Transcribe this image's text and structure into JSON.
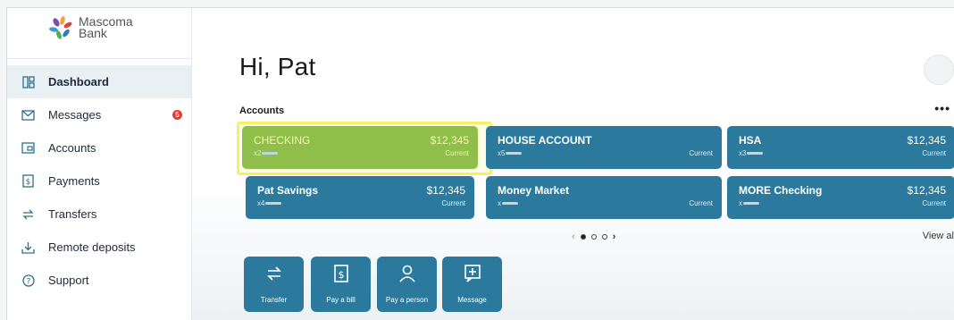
{
  "brand": {
    "name_line1": "Mascoma",
    "name_line2": "Bank"
  },
  "sidebar": {
    "items": [
      {
        "label": "Dashboard",
        "icon": "dashboard-icon",
        "active": true
      },
      {
        "label": "Messages",
        "icon": "envelope-icon",
        "badge": "5"
      },
      {
        "label": "Accounts",
        "icon": "accounts-icon"
      },
      {
        "label": "Payments",
        "icon": "dollar-doc-icon"
      },
      {
        "label": "Transfers",
        "icon": "transfer-arrows-icon"
      },
      {
        "label": "Remote deposits",
        "icon": "deposit-icon"
      },
      {
        "label": "Support",
        "icon": "help-circle-icon"
      }
    ]
  },
  "main": {
    "greeting": "Hi, Pat",
    "accounts_label": "Accounts",
    "more": "•••",
    "cards": [
      {
        "name": "CHECKING",
        "acct": "x2",
        "balance": "$12,345",
        "status": "Current"
      },
      {
        "name": "HOUSE ACCOUNT",
        "acct": "x5",
        "balance": "",
        "status": "Current"
      },
      {
        "name": "HSA",
        "acct": "x3",
        "balance": "$12,345",
        "status": "Current"
      },
      {
        "name": "Pat Savings",
        "acct": "x4",
        "balance": "$12,345",
        "status": "Current"
      },
      {
        "name": "Money Market",
        "acct": "x",
        "balance": "",
        "status": "Current"
      },
      {
        "name": "MORE Checking",
        "acct": "x",
        "balance": "$12,345",
        "status": "Current"
      }
    ],
    "pager": {
      "prev": "‹",
      "next": "›"
    },
    "view_all": "View al",
    "quick_actions": [
      {
        "label": "Transfer",
        "icon": "transfer-icon"
      },
      {
        "label": "Pay a bill",
        "icon": "bill-icon"
      },
      {
        "label": "Pay a person",
        "icon": "person-icon"
      },
      {
        "label": "Message",
        "icon": "message-icon"
      }
    ]
  },
  "colors": {
    "card": "#2b7a9e",
    "highlight_card": "#8fbf4a",
    "highlight_border": "#f4f168",
    "badge": "#e53935"
  }
}
